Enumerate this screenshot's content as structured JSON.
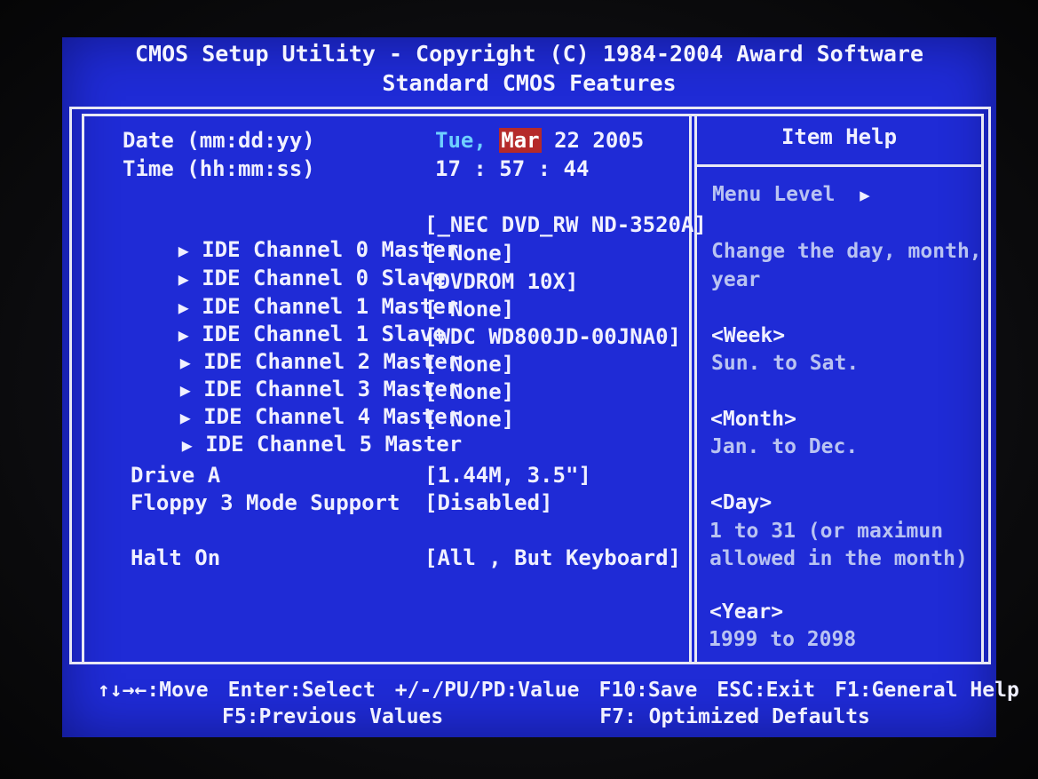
{
  "header": {
    "title": "CMOS Setup Utility - Copyright (C) 1984-2004 Award Software",
    "subtitle": "Standard CMOS Features"
  },
  "date": {
    "label": "Date (mm:dd:yy)",
    "day_of_week": "Tue,",
    "month": "Mar",
    "day_year": "22 2005"
  },
  "time": {
    "label": "Time (hh:mm:ss)",
    "value": "17 : 57 : 44"
  },
  "ide_channels": [
    {
      "label": "IDE Channel 0 Master",
      "value": "[_NEC DVD_RW ND-3520A]"
    },
    {
      "label": "IDE Channel 0 Slave",
      "value": "[ None]"
    },
    {
      "label": "IDE Channel 1 Master",
      "value": "[DVDROM 10X]"
    },
    {
      "label": "IDE Channel 1 Slave",
      "value": "[ None]"
    },
    {
      "label": "IDE Channel 2 Master",
      "value": "[WDC WD800JD-00JNA0]"
    },
    {
      "label": "IDE Channel 3 Master",
      "value": "[ None]"
    },
    {
      "label": "IDE Channel 4 Master",
      "value": "[ None]"
    },
    {
      "label": "IDE Channel 5 Master",
      "value": "[ None]"
    }
  ],
  "drive_a": {
    "label": "Drive A",
    "value": "[1.44M, 3.5\"]"
  },
  "floppy_3_mode": {
    "label": "Floppy 3 Mode Support",
    "value": "[Disabled]"
  },
  "halt_on": {
    "label": "Halt On",
    "value": "[All , But Keyboard]"
  },
  "item_help": {
    "title": "Item Help",
    "menu_level": "Menu Level",
    "menu_level_arrow": "▶",
    "lines": [
      "Change the day, month,",
      "year"
    ],
    "week_key": "<Week>",
    "week_text": "Sun. to Sat.",
    "month_key": "<Month>",
    "month_text": "Jan. to Dec.",
    "day_key": "<Day>",
    "day_text_1": "1 to 31 (or maximun",
    "day_text_2": "allowed in the month)",
    "year_key": "<Year>",
    "year_text": "1999 to 2098"
  },
  "footer": {
    "move": "↑↓→←:Move",
    "select": "Enter:Select",
    "value": "+/-/PU/PD:Value",
    "save": "F10:Save",
    "exit": "ESC:Exit",
    "help": "F1:General Help",
    "previous": "F5:Previous Values",
    "optimized": "F7: Optimized Defaults"
  },
  "icons": {
    "submenu_arrow": "▶"
  },
  "colors": {
    "background": "#1f2bd6",
    "text": "#f0f0ff",
    "help_text": "#b9c3f2",
    "day_of_week": "#6fd0ff",
    "highlight": "#b52a2a"
  }
}
